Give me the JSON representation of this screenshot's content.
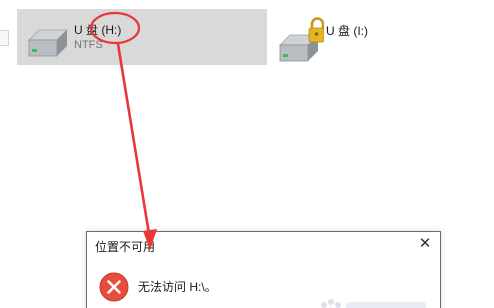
{
  "drives": [
    {
      "name": "U 盘 (H:)",
      "filesystem": "NTFS",
      "icon": "usb-drive-icon",
      "selected": true
    },
    {
      "name": "U 盘 (I:)",
      "filesystem": "",
      "icon": "locked-usb-drive-icon",
      "selected": false
    }
  ],
  "dialog": {
    "title": "位置不可用",
    "message": "无法访问 H:\\。",
    "close_glyph": "✕",
    "icon": "error-icon"
  },
  "annotation": {
    "color": "#e8363b",
    "shapes": [
      "circle",
      "arrow"
    ]
  },
  "colors": {
    "selected_tile": "#d9d9d9",
    "error_red": "#e74c3c",
    "lock_gold": "#e6b422"
  }
}
